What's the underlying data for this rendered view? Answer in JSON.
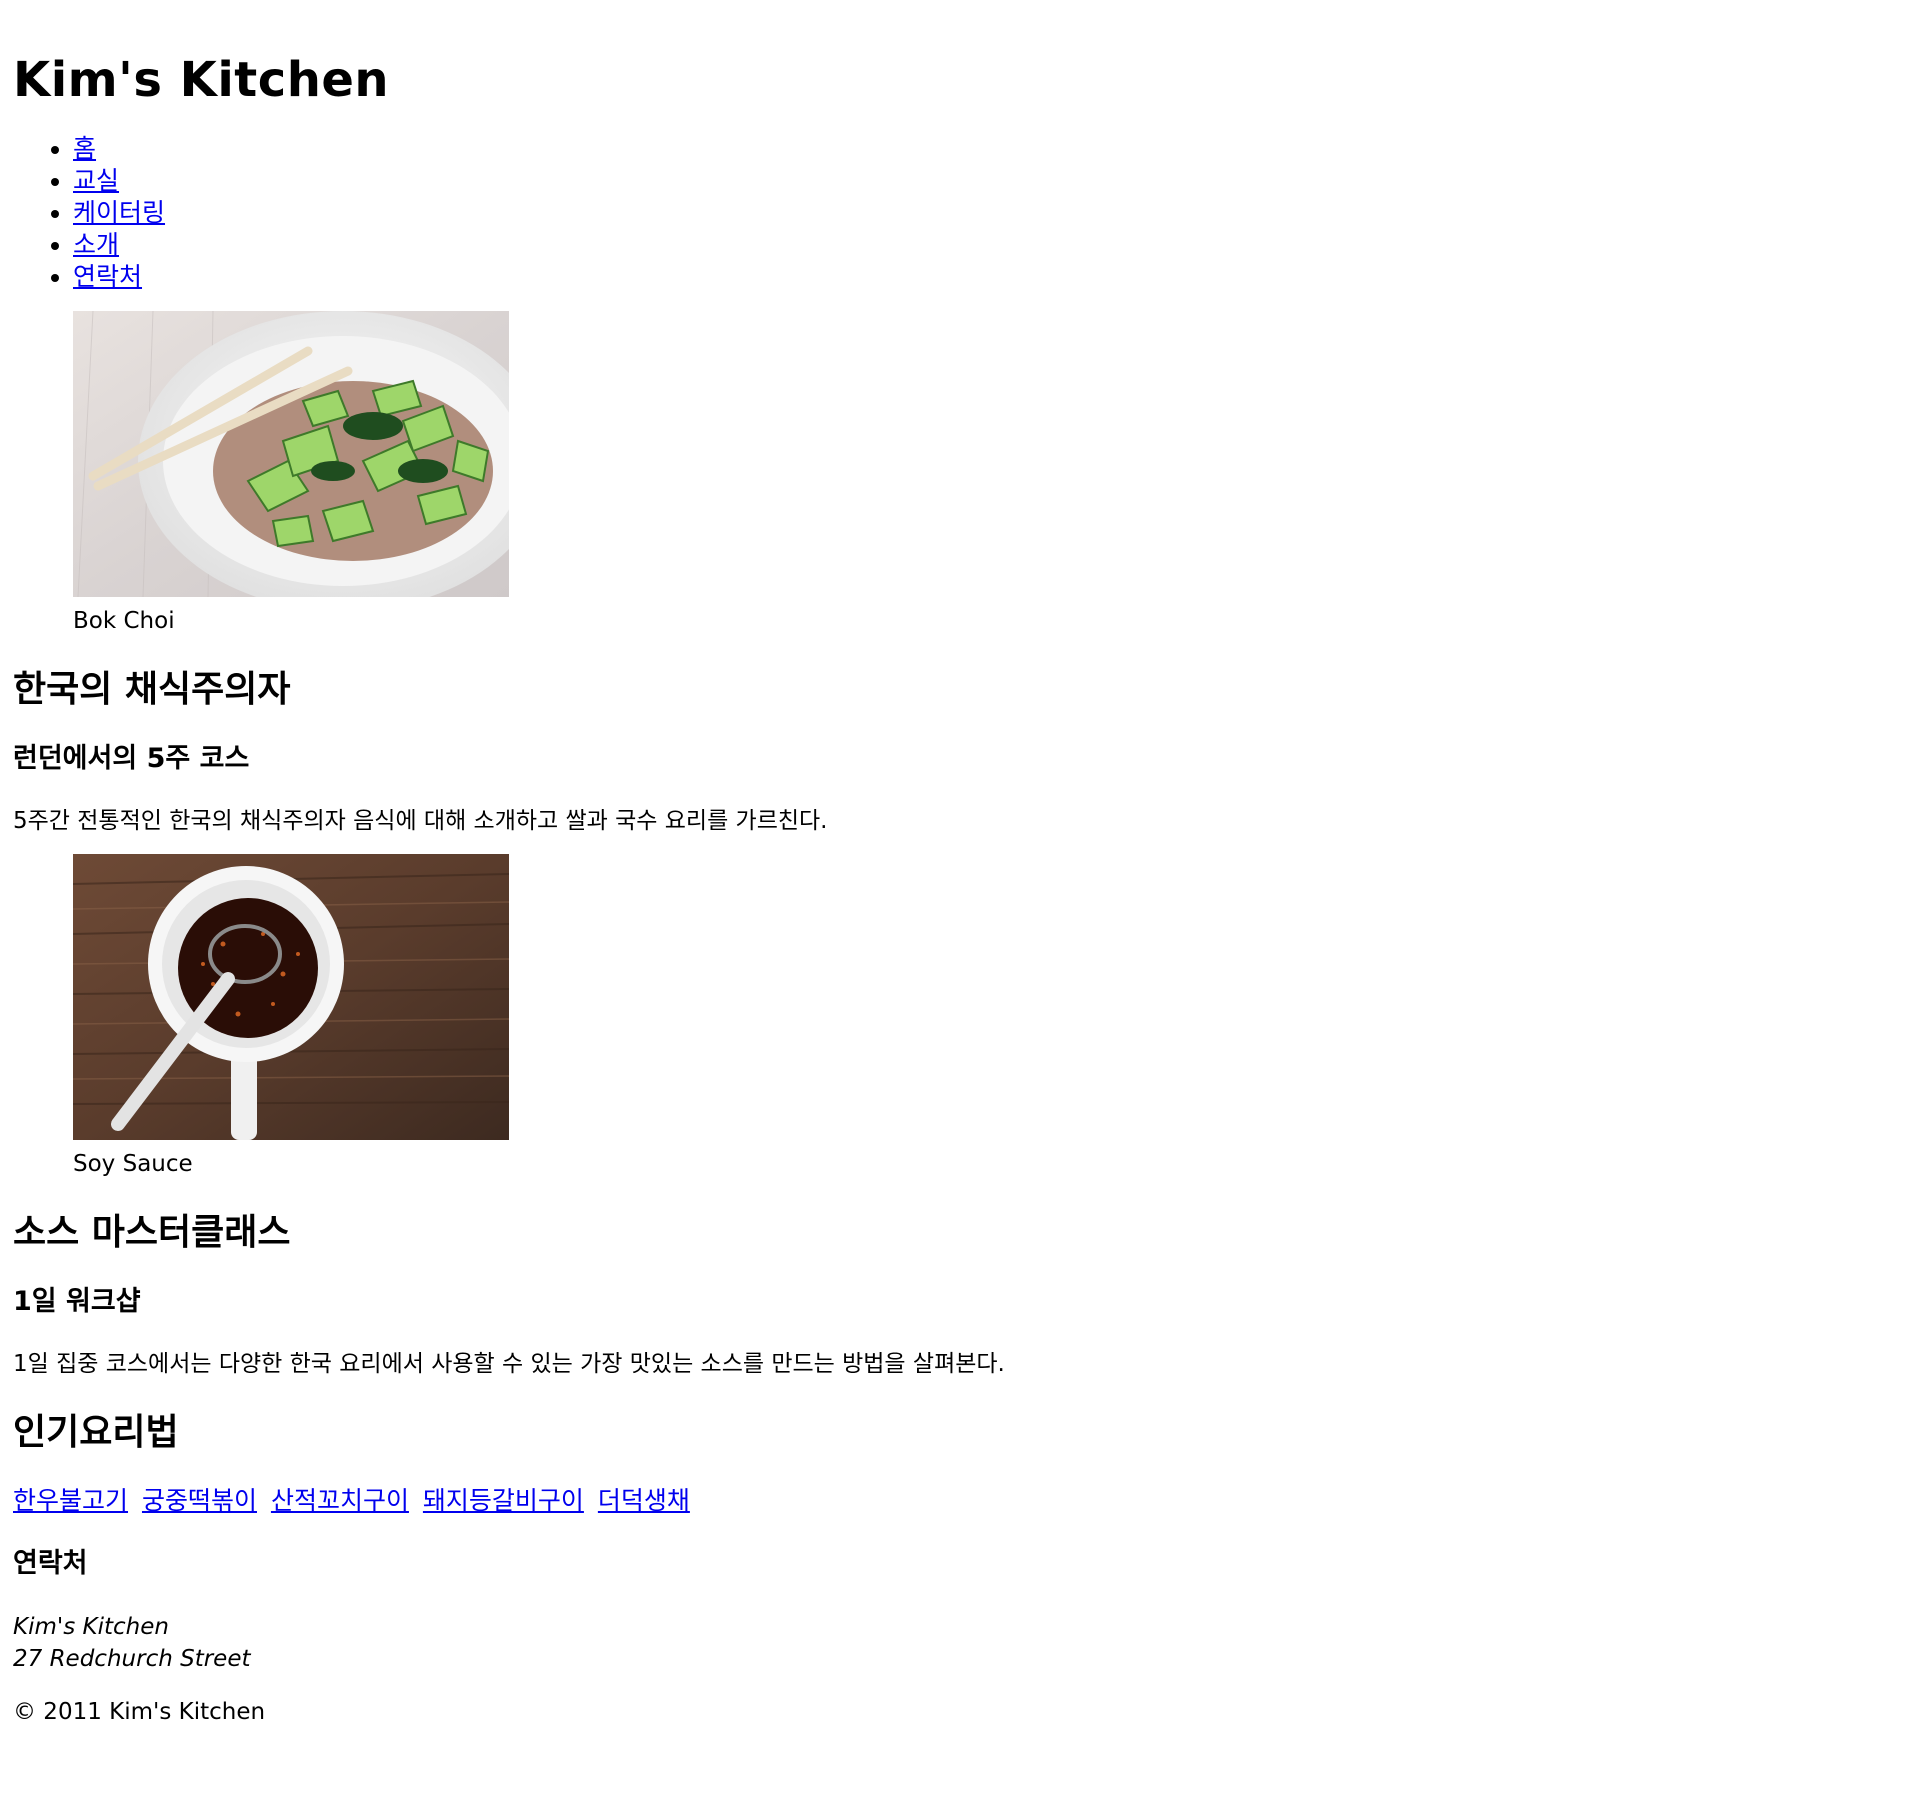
{
  "site": {
    "title": "Kim's Kitchen"
  },
  "nav": {
    "items": [
      "홈",
      "교실",
      "케이터링",
      "소개",
      "연락처"
    ]
  },
  "figures": {
    "bok_choi": {
      "caption": "Bok Choi"
    },
    "soy_sauce": {
      "caption": "Soy Sauce"
    }
  },
  "vegetarian": {
    "heading": "한국의 채식주의자",
    "subheading": "런던에서의 5주 코스",
    "description": "5주간 전통적인 한국의 채식주의자 음식에 대해 소개하고 쌀과 국수 요리를 가르친다."
  },
  "sauce": {
    "heading": "소스 마스터클래스",
    "subheading": "1일 워크샵",
    "description": "1일 집중 코스에서는 다양한 한국 요리에서 사용할 수 있는 가장 맛있는 소스를 만드는 방법을 살펴본다."
  },
  "popular": {
    "heading": "인기요리법",
    "recipes": [
      "한우불고기",
      "궁중떡볶이",
      "산적꼬치구이",
      "돼지등갈비구이",
      "더덕생채"
    ]
  },
  "contact": {
    "heading": "연락처",
    "name": "Kim's Kitchen",
    "street": "27 Redchurch Street"
  },
  "footer": {
    "copyright": "© 2011 Kim's Kitchen"
  },
  "colors": {
    "link": "#0000ee",
    "text": "#000000",
    "background": "#ffffff"
  }
}
